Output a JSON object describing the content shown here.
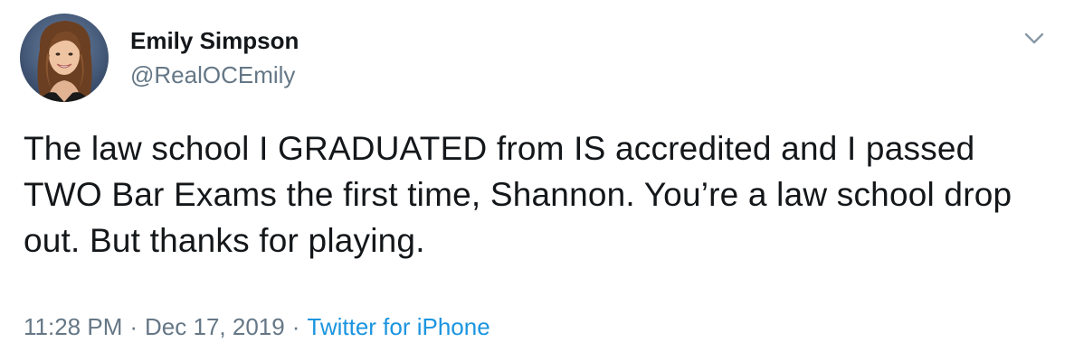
{
  "user": {
    "display_name": "Emily Simpson",
    "handle": "@RealOCEmily",
    "avatar_icon": "profile-photo"
  },
  "tweet": {
    "text": "The law school I GRADUATED from IS accredited and I passed TWO Bar Exams the first time, Shannon. You’re a law school drop out. But thanks for playing."
  },
  "meta": {
    "time": "11:28 PM",
    "separator": "·",
    "date": "Dec 17, 2019",
    "source": "Twitter for iPhone"
  },
  "menu": {
    "icon": "chevron-down-icon"
  },
  "colors": {
    "text": "#14171a",
    "secondary": "#657786",
    "link": "#1b95e0"
  }
}
